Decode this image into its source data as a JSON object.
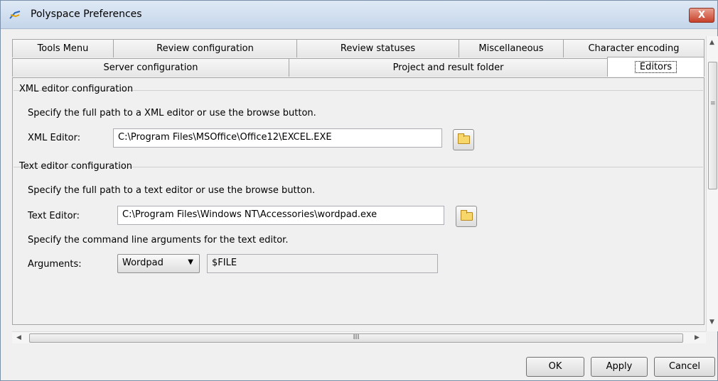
{
  "window": {
    "title": "Polyspace Preferences",
    "close_label": "X"
  },
  "tabs": {
    "row1": [
      "Tools Menu",
      "Review configuration",
      "Review statuses",
      "Miscellaneous",
      "Character encoding"
    ],
    "row2": [
      "Server configuration",
      "Project and result folder",
      "Editors"
    ],
    "active": "Editors"
  },
  "xml_group": {
    "title": "XML editor configuration",
    "description": "Specify the full path to a XML editor or use the browse button.",
    "label": "XML Editor:",
    "value": "C:\\Program Files\\MSOffice\\Office12\\EXCEL.EXE"
  },
  "text_group": {
    "title": "Text editor configuration",
    "description": "Specify the full path to a text editor or use the browse button.",
    "label": "Text Editor:",
    "value": "C:\\Program Files\\Windows NT\\Accessories\\wordpad.exe",
    "args_description": "Specify the command line arguments for the text editor.",
    "args_label": "Arguments:",
    "args_select": "Wordpad",
    "args_value": "$FILE"
  },
  "scroll": {
    "h_grip": "III",
    "v_grip": "≡"
  },
  "buttons": {
    "ok": "OK",
    "apply": "Apply",
    "cancel": "Cancel"
  },
  "icons": {
    "app": "polyspace-app-icon",
    "browse": "folder-icon"
  }
}
